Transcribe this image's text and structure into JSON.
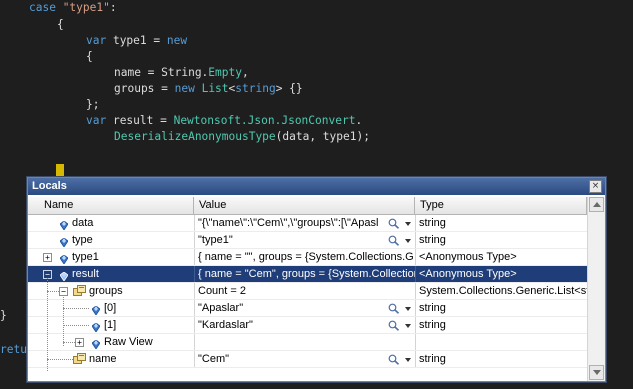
{
  "editor": {
    "lines": [
      [
        [
          "tok-kw",
          "case "
        ],
        [
          "tok-str",
          "\"type1\""
        ],
        [
          "tok-punc",
          ":"
        ]
      ],
      [
        [
          "tok-punc",
          "{"
        ]
      ],
      [
        [
          "tok-kw",
          "var "
        ],
        [
          "tok-id",
          "type1 = "
        ],
        [
          "tok-kw",
          "new"
        ]
      ],
      [
        [
          "tok-punc",
          "{"
        ]
      ],
      [
        [
          "tok-id",
          "name = String."
        ],
        [
          "tok-type",
          "Empty"
        ],
        [
          "tok-punc",
          ","
        ]
      ],
      [
        [
          "tok-id",
          "groups = "
        ],
        [
          "tok-kw",
          "new "
        ],
        [
          "tok-type",
          "List"
        ],
        [
          "tok-punc",
          "<"
        ],
        [
          "tok-kw",
          "string"
        ],
        [
          "tok-punc",
          "> {}"
        ]
      ],
      [
        [
          "tok-punc",
          "};"
        ]
      ],
      [
        [
          "tok-kw",
          "var "
        ],
        [
          "tok-id",
          "result = "
        ],
        [
          "tok-type",
          "Newtonsoft.Json.JsonConvert"
        ],
        [
          "tok-punc",
          "."
        ]
      ],
      [
        [
          "tok-type",
          "DeserializeAnonymousType"
        ],
        [
          "tok-punc",
          "(data, type1);"
        ]
      ],
      [
        [
          "tok-punc",
          "}"
        ]
      ],
      [
        [
          "tok-kw",
          "retu"
        ]
      ]
    ]
  },
  "locals": {
    "title": "Locals",
    "close_glyph": "×",
    "columns": {
      "name": "Name",
      "value": "Value",
      "type": "Type"
    },
    "rows": [
      {
        "name": "data",
        "value": "\"{\\\"name\\\":\\\"Cem\\\",\\\"groups\\\":[\\\"Apasl",
        "type": "string",
        "icon": "gem",
        "depth": 0,
        "expander": "",
        "mag": true
      },
      {
        "name": "type",
        "value": "\"type1\"",
        "type": "string",
        "icon": "gem",
        "depth": 0,
        "expander": "",
        "mag": true
      },
      {
        "name": "type1",
        "value": "{ name = \"\", groups = {System.Collections.G",
        "type": "<Anonymous Type>",
        "icon": "gem",
        "depth": 0,
        "expander": "+",
        "mag": false
      },
      {
        "name": "result",
        "value": "{ name = \"Cem\", groups = {System.Collection",
        "type": "<Anonymous Type>",
        "icon": "gem",
        "depth": 0,
        "expander": "−",
        "mag": false,
        "selected": true
      },
      {
        "name": "groups",
        "value": "Count = 2",
        "type": "System.Collections.Generic.List<st",
        "icon": "obj",
        "depth": 1,
        "expander": "−",
        "mag": false
      },
      {
        "name": "[0]",
        "value": "\"Apaslar\"",
        "type": "string",
        "icon": "gem",
        "depth": 2,
        "expander": "",
        "mag": true
      },
      {
        "name": "[1]",
        "value": "\"Kardaslar\"",
        "type": "string",
        "icon": "gem",
        "depth": 2,
        "expander": "",
        "mag": true
      },
      {
        "name": "Raw View",
        "value": "",
        "type": "",
        "icon": "gem",
        "depth": 2,
        "expander": "+",
        "mag": false
      },
      {
        "name": "name",
        "value": "\"Cem\"",
        "type": "string",
        "icon": "obj",
        "depth": 1,
        "expander": "",
        "mag": true
      }
    ]
  },
  "colors": {
    "editor_bg": "#1e1e1e",
    "keyword": "#569cd6",
    "string": "#d69d85",
    "type": "#4ec9b0",
    "selection": "#1f3d78",
    "title_bar": "#2a4a80"
  }
}
